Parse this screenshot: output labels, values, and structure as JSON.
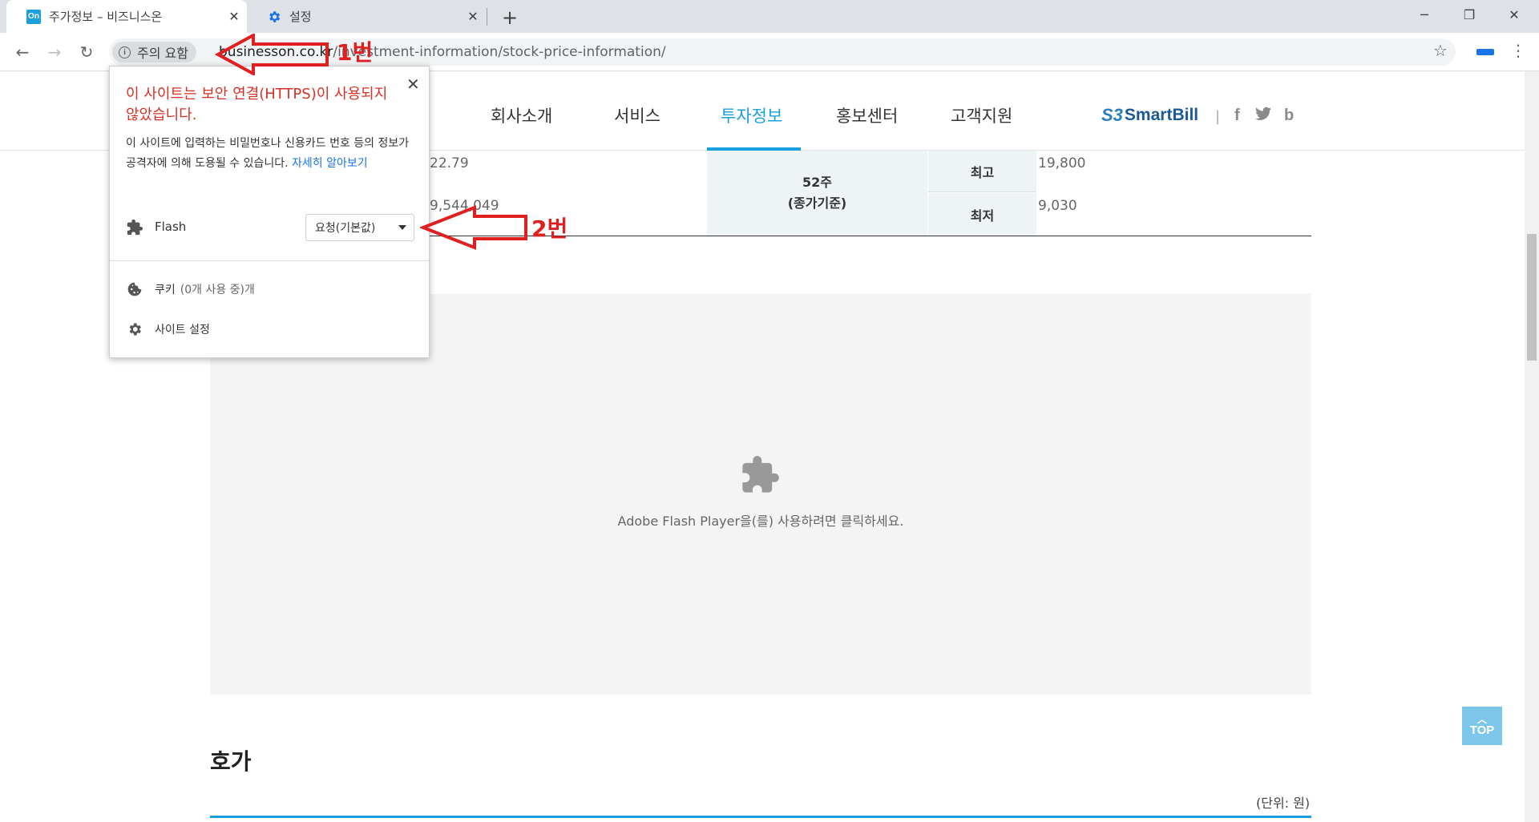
{
  "tabs": [
    {
      "title": "주가정보 – 비즈니스온",
      "favicon": "On",
      "active": true
    },
    {
      "title": "설정",
      "favicon": "gear-icon",
      "active": false
    }
  ],
  "omnibox": {
    "security_label": "주의 요함",
    "url_host": "businesson.co.kr",
    "url_path": "/investment-information/stock-price-information/"
  },
  "site_nav": {
    "items": [
      "회사소개",
      "서비스",
      "투자정보",
      "홍보센터",
      "고객지원"
    ],
    "active_index": 2,
    "brand_mark": "S3",
    "brand_name": "SmartBill",
    "brand_divider": "|",
    "social": [
      "f",
      "t",
      "b"
    ]
  },
  "stock_table": {
    "value_top": "22.79",
    "value_bottom": "9,544,049",
    "week52_label": "52주",
    "week52_sub": "(종가기준)",
    "high_label": "최고",
    "high_value": "19,800",
    "low_label": "최저",
    "low_value": "9,030"
  },
  "flash_placeholder": {
    "message": "Adobe Flash Player을(를) 사용하려면 클릭하세요."
  },
  "quote_section": {
    "title": "호가",
    "unit": "(단위: 원)"
  },
  "top_button": {
    "label": "TOP"
  },
  "site_info_popup": {
    "warning": "이 사이트는 보안 연결(HTTPS)이 사용되지 않았습니다.",
    "description": "이 사이트에 입력하는 비밀번호나 신용카드 번호 등의 정보가 공격자에 의해 도용될 수 있습니다.",
    "learn_more": "자세히 알아보기",
    "flash_label": "Flash",
    "flash_setting": "요청(기본값)",
    "cookies_label": "쿠키",
    "cookies_detail": "(0개 사용 중)개",
    "site_settings_label": "사이트 설정"
  },
  "annotations": {
    "step1": "1번",
    "step2": "2번",
    "color": "#e02020"
  },
  "colors": {
    "accent": "#1aa0e0",
    "warning": "#d93025",
    "link": "#1a73e8"
  }
}
